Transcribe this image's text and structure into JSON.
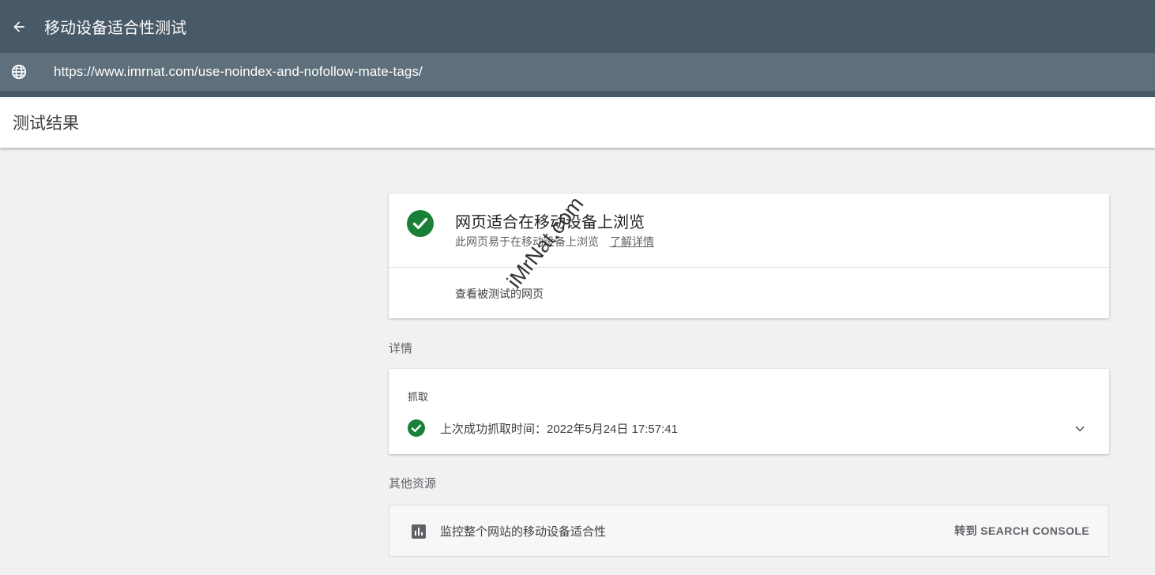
{
  "header": {
    "title": "移动设备适合性测试",
    "back_icon": "arrow-left-icon"
  },
  "url_bar": {
    "url": "https://www.imrnat.com/use-noindex-and-nofollow-mate-tags/",
    "icon": "globe-icon"
  },
  "results": {
    "title": "测试结果"
  },
  "summary": {
    "title": "网页适合在移动设备上浏览",
    "subtitle": "此网页易于在移动设备上浏览",
    "learn_more": "了解详情",
    "view_page": "查看被测试的网页",
    "status_color": "#188038"
  },
  "details": {
    "label": "详情",
    "crawl": {
      "heading": "抓取",
      "status_text": "上次成功抓取时间：2022年5月24日 17:57:41"
    }
  },
  "other_resources": {
    "label": "其他资源",
    "item_text": "监控整个网站的移动设备适合性",
    "button_label": "转到 SEARCH CONSOLE",
    "icon": "bar-chart-icon"
  },
  "watermark": "iMrNat.com",
  "colors": {
    "topbar": "#485967",
    "urlbar": "#5f707c",
    "success_green": "#188038"
  }
}
